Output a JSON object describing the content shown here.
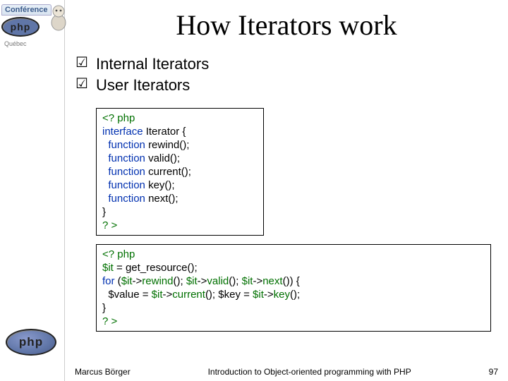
{
  "logo": {
    "conference": "Conférence",
    "subtext": "Québec",
    "php": "php"
  },
  "title": "How Iterators work",
  "bullets": [
    "Internal Iterators",
    "User Iterators"
  ],
  "code1": {
    "open": "<? php",
    "kw_interface": "interface",
    "iname": "Iterator",
    "brace_open": "{",
    "kw_function": "function",
    "m1": "rewind",
    "m2": "valid",
    "m3": "current",
    "m4": "key",
    "m5": "next",
    "parens": "();",
    "brace_close": "}",
    "close": "? >"
  },
  "code2": {
    "open": "<? php",
    "l1a": "$it",
    "l1b": " = get_resource();",
    "for": "for",
    "p_open": " (",
    "it": "$it",
    "arrow": "->",
    "rewind": "rewind",
    "valid": "valid",
    "next": "next",
    "sep1": "(); ",
    "sep2": "(); ",
    "sep3": "()) {",
    "l3a": "  $value = ",
    "current": "current",
    "l3b": "(); $key = ",
    "key": "key",
    "l3c": "();",
    "brace_close": "}",
    "close": "? >"
  },
  "footer": {
    "author": "Marcus Börger",
    "course": "Introduction to Object-oriented programming with PHP",
    "page": "97"
  }
}
